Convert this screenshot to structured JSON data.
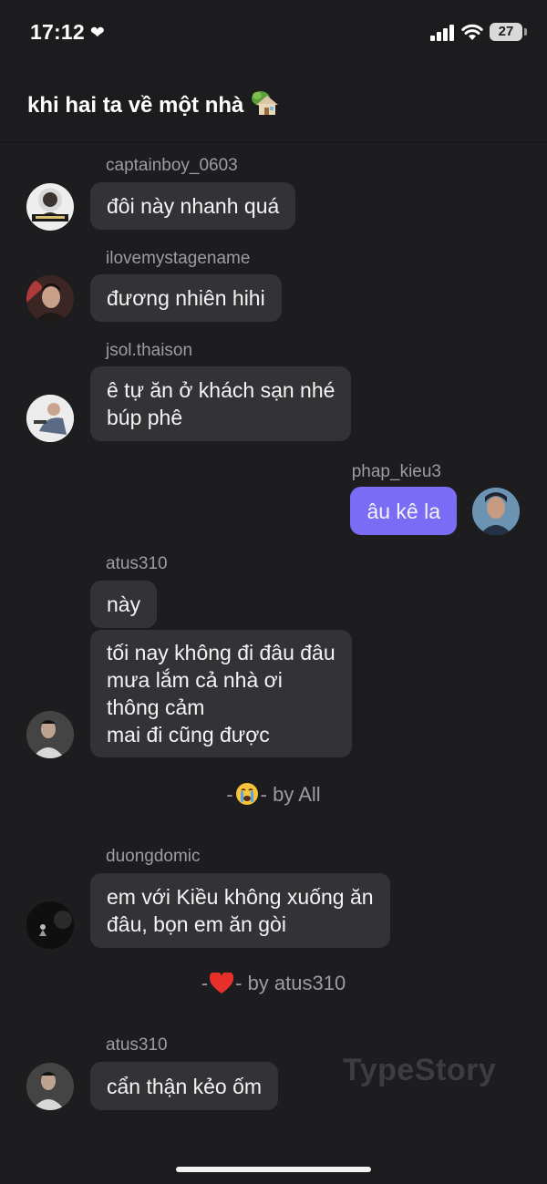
{
  "status": {
    "time": "17:12",
    "battery": "27"
  },
  "header": {
    "title": "khi hai ta về một nhà"
  },
  "messages": [
    {
      "user": "captainboy_0603",
      "lines": [
        "đôi này nhanh quá"
      ]
    },
    {
      "user": "ilovemystagename",
      "lines": [
        "đương nhiên hihi"
      ]
    },
    {
      "user": "jsol.thaison",
      "lines": [
        "ê tự ăn ở khách sạn nhé",
        "búp phê"
      ]
    },
    {
      "user": "phap_kieu3",
      "lines": [
        "âu kê la"
      ]
    },
    {
      "user": "atus310",
      "lines": [
        "này"
      ]
    },
    {
      "user": "",
      "lines": [
        "tối nay không đi đâu đâu",
        "mưa lắm cả nhà ơi",
        "thông cảm",
        "mai đi cũng được"
      ]
    },
    {
      "user": "duongdomic",
      "lines": [
        "em với Kiều không xuống ăn",
        "đâu, bọn em ăn gòi"
      ]
    },
    {
      "user": "atus310",
      "lines": [
        "cẩn thận kẻo ốm"
      ]
    }
  ],
  "reactions": [
    {
      "prefix": "-",
      "suffix": "- by All",
      "emoji": "crying-face-icon"
    },
    {
      "prefix": "-",
      "suffix": "- by atus310",
      "emoji": "heart-icon"
    }
  ],
  "watermark": "TypeStory",
  "colors": {
    "background": "#1d1d1f",
    "bubble": "#333335",
    "my_bubble": "#7b6cf6",
    "username": "#9c9ca3"
  }
}
